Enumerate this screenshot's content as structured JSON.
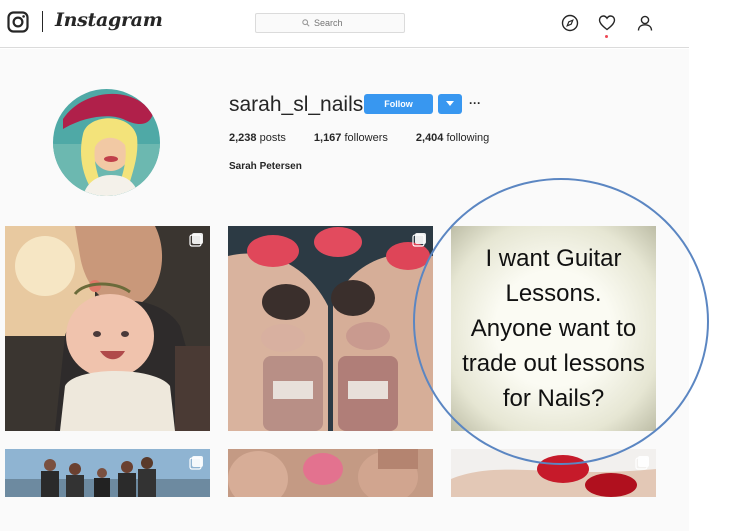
{
  "header": {
    "logo_text": "Instagram",
    "search_placeholder": "Search",
    "icons": [
      "instagram-logo-icon",
      "search-icon",
      "compass-icon",
      "heart-icon",
      "profile-icon"
    ]
  },
  "profile": {
    "username": "sarah_sl_nails",
    "follow_label": "Follow",
    "more_label": "···",
    "stats": {
      "posts_count": "2,238",
      "posts_label": "posts",
      "followers_count": "1,167",
      "followers_label": "followers",
      "following_count": "2,404",
      "following_label": "following"
    },
    "full_name": "Sarah Petersen"
  },
  "posts": {
    "text_post": [
      "I want Guitar",
      "Lessons.",
      "Anyone want to",
      "trade out lessons",
      "for Nails?"
    ]
  },
  "colors": {
    "follow_blue": "#3897f0",
    "annotation_circle": "#5b86c2",
    "notification_dot": "#ed4956"
  }
}
